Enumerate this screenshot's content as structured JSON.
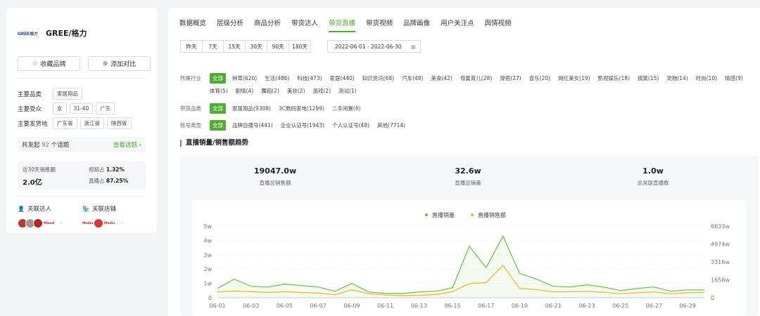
{
  "brand": {
    "logo_text": "GREE格力",
    "name": "GREE/格力",
    "favorite_label": "收藏品牌",
    "compare_label": "添加对比",
    "main_category_label": "主要品类",
    "main_category": [
      "家居用品"
    ],
    "audience_label": "主要受众",
    "audience": [
      "女",
      "31-40",
      "广东"
    ],
    "ship_label": "主要发货地",
    "ship_regions": [
      "广东省",
      "浙江省",
      "陕西省"
    ],
    "topics_prefix": "共发起",
    "topics_count": "92",
    "topics_suffix": "个话题",
    "topics_link": "查看话题 ›",
    "sales_label": "近30天销售额",
    "sales_value": "2.0亿",
    "video_share_label": "视频占",
    "video_share_value": "1.32%",
    "live_share_label": "直播占",
    "live_share_value": "87.25%",
    "related_influencers": "关联达人",
    "related_shops": "关联店铺",
    "more": "···"
  },
  "nav": {
    "tabs": [
      "数据概览",
      "层级分析",
      "商品分析",
      "带货达人",
      "带货直播",
      "带货视频",
      "品牌画像",
      "用户关注点",
      "舆情视频"
    ],
    "active_index": 4
  },
  "date_ranges": [
    "昨天",
    "7天",
    "15天",
    "30天",
    "90天",
    "180天"
  ],
  "date_range_value": "2022-06-01  - 2022-06-30",
  "filters": {
    "industry_label": "所属行业",
    "industry": [
      "全部",
      "种草(620)",
      "生活(486)",
      "科技(473)",
      "家居(440)",
      "知识资讯(68)",
      "汽车(48)",
      "美食(42)",
      "母婴育儿(28)",
      "穿搭(27)",
      "音乐(20)",
      "网红美女(19)",
      "影视娱乐(18)",
      "搞笑(15)",
      "宠物(14)",
      "时尚(10)",
      "情感(9)",
      "体育(5)",
      "剧情(4)",
      "舞蹈(2)",
      "美妆(2)",
      "游戏(2)",
      "测试(1)"
    ],
    "category_label": "带货品类",
    "category": [
      "全部",
      "家居用品(9308)",
      "3C数码家电(1299)",
      "二手闲置(6)"
    ],
    "account_label": "账号类型",
    "account": [
      "全部",
      "品牌自播号(441)",
      "企业认证号(1943)",
      "个人认证号(48)",
      "其他(7714)"
    ]
  },
  "trend": {
    "title": "直播销量/销售额趋势",
    "kpis": [
      {
        "value": "19047.0w",
        "label": "直播总销售额"
      },
      {
        "value": "32.6w",
        "label": "直播总销量"
      },
      {
        "value": "1.0w",
        "label": "总关联直播数"
      }
    ]
  },
  "colors": {
    "accent": "#4cae2c",
    "series_sales_volume": "#63c23f",
    "series_sales_amount": "#f5b31a"
  },
  "chart_data": {
    "type": "line",
    "legend": [
      "直播销量",
      "直播销售额"
    ],
    "legend_position": "top-center",
    "x": [
      "06-01",
      "06-02",
      "06-03",
      "06-04",
      "06-05",
      "06-06",
      "06-07",
      "06-08",
      "06-09",
      "06-10",
      "06-11",
      "06-12",
      "06-13",
      "06-14",
      "06-15",
      "06-16",
      "06-17",
      "06-18",
      "06-19",
      "06-20",
      "06-21",
      "06-22",
      "06-23",
      "06-24",
      "06-25",
      "06-26",
      "06-27",
      "06-28",
      "06-29",
      "06-30"
    ],
    "x_tick_labels": [
      "06-01",
      "06-03",
      "06-05",
      "06-07",
      "06-09",
      "06-11",
      "06-13",
      "06-15",
      "06-17",
      "06-19",
      "06-21",
      "06-23",
      "06-25",
      "06-27",
      "06-29"
    ],
    "y_left_ticks": [
      "0",
      "1w",
      "2w",
      "3w",
      "4w",
      "5w"
    ],
    "y_left_range": [
      0,
      5
    ],
    "y_right_ticks": [
      "0",
      "1658w",
      "3316w",
      "4974w",
      "6633w"
    ],
    "y_right_range": [
      0,
      6633
    ],
    "series": [
      {
        "name": "直播销量",
        "axis": "left",
        "values": [
          0.65,
          1.3,
          0.8,
          0.75,
          0.95,
          0.85,
          0.75,
          0.45,
          1.0,
          0.4,
          0.3,
          0.3,
          0.4,
          0.45,
          0.7,
          3.6,
          2.1,
          4.3,
          1.7,
          1.3,
          0.8,
          0.75,
          0.9,
          0.75,
          0.5,
          0.65,
          0.75,
          0.45,
          0.55,
          0.55
        ]
      },
      {
        "name": "直播销售额",
        "axis": "right",
        "values": [
          530,
          620,
          560,
          490,
          560,
          490,
          430,
          270,
          730,
          380,
          250,
          200,
          230,
          300,
          570,
          1300,
          1400,
          3000,
          860,
          760,
          540,
          550,
          590,
          510,
          380,
          460,
          540,
          370,
          460,
          510
        ]
      }
    ],
    "grid": true
  }
}
